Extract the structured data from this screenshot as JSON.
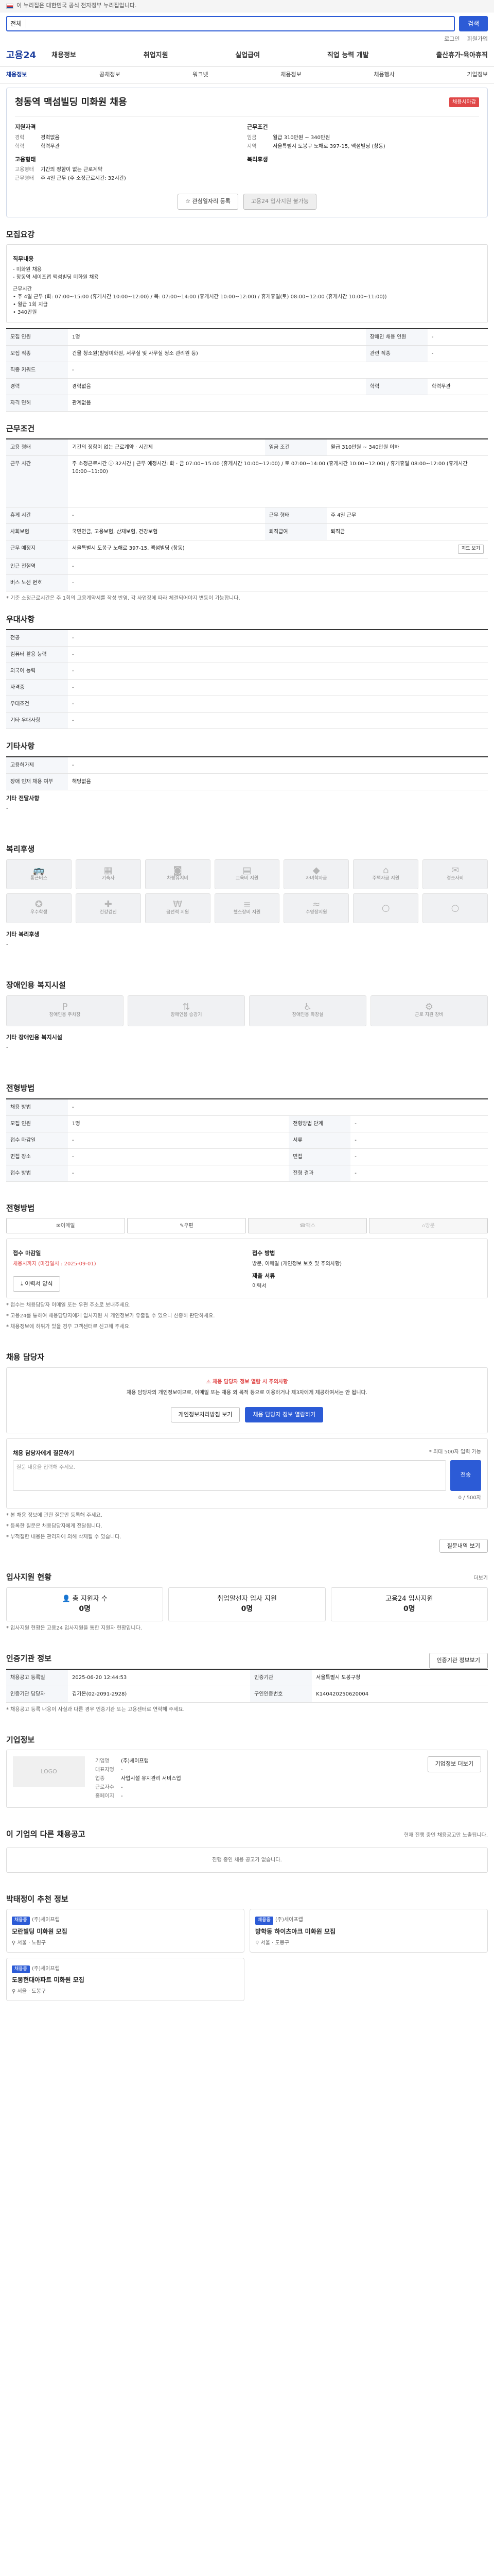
{
  "topbar": {
    "notice": "이 누리집은 대한민국 공식 전자정부 누리집입니다."
  },
  "search": {
    "scope": "전체",
    "placeholder": "",
    "button": "검색"
  },
  "toplinks": [
    "로그인",
    "회원가입"
  ],
  "gnb": {
    "logo": "고용24",
    "menu": [
      "채용정보",
      "취업지원",
      "실업급여",
      "직업 능력 개발",
      "출산휴가·육아휴직"
    ]
  },
  "lnb": {
    "items": [
      "채용정보",
      "공채정보",
      "워크넷",
      "채용정보",
      "채용행사",
      "기업정보"
    ],
    "active_index": 0
  },
  "job": {
    "title": "청동역 맥섬빌딩 미화원 채용",
    "deadline_badge": "채용시마감",
    "qualification": {
      "heading": "지원자격",
      "rows": [
        {
          "k": "경력",
          "v": "경력없음"
        },
        {
          "k": "학력",
          "v": "학력무관"
        }
      ]
    },
    "conditions": {
      "heading": "근무조건",
      "rows": [
        {
          "k": "임금",
          "v": "월급 310만원 ~ 340만원"
        },
        {
          "k": "지역",
          "v": "서울특별시 도봉구 노해로 397-15, 맥섬빌딩 (창동)"
        }
      ]
    },
    "employment": {
      "heading": "고용형태",
      "rows": [
        {
          "k": "고용형태",
          "v": "기간의 정함이 없는 근로계약"
        },
        {
          "k": "근무형태",
          "v": "주 4일 근무 (주 소정근로시간: 32시간)"
        }
      ]
    },
    "company": {
      "heading": "복리후생",
      "rows": []
    },
    "btn_interest": "관심일자리 등록",
    "btn_apply": "고용24 입사지원 불가능"
  },
  "recruit": {
    "heading": "모집요강",
    "duty_heading": "직무내용",
    "duty_lines": [
      "- 미화원 채용",
      "- 창동역 세이프랩 맥섬빌딩 미화원 채용",
      "",
      "근무시간",
      "• 주 4일 근무 (화: 07:00~15:00 (휴게시간 10:00~12:00) / 목: 07:00~14:00 (휴게시간 10:00~12:00) / 휴게휴일(토) 08:00~12:00 (휴게시간 10:00~11:00))",
      "• 월급 1회 지급",
      "• 340만원"
    ],
    "rows": [
      {
        "k": "모집 인원",
        "v": "1명",
        "k2": "장애인 채용 인원",
        "v2": "-"
      },
      {
        "k": "모집 직종",
        "v": "건물 청소원(빌딩미화원, 서무실 및 사무실 청소 관리원 등)",
        "k2": "관련 직종",
        "v2": "-"
      },
      {
        "k": "직종 키워드",
        "v": "-",
        "k2": "",
        "v2": ""
      },
      {
        "k": "경력",
        "v": "경력없음",
        "k2": "학력",
        "v2": "학력무관"
      },
      {
        "k": "자격 면허",
        "v": "관계없음",
        "k2": "",
        "v2": ""
      }
    ]
  },
  "work": {
    "heading": "근무조건",
    "rows": [
      {
        "k": "고용 형태",
        "v": "기간의 정함이 없는 근로계약 · 시간제",
        "k2": "임금 조건",
        "v2": "월급 310만원 ~ 340만원 이하"
      },
      {
        "k": "근무 시간",
        "v": "주 소정근로시간 ⓘ 32시간  |  근무 예정시간: 화 · 금 07:00~15:00 (휴게시간 10:00~12:00) / 토 07:00~14:00 (휴게시간 10:00~12:00) / 휴게휴일 08:00~12:00 (휴게시간 10:00~11:00)",
        "k2": "",
        "v2": ""
      },
      {
        "k": "휴게 시간",
        "v": "-",
        "k2": "근무 형태",
        "v2": "주 4일 근무"
      },
      {
        "k": "사회보험",
        "v": "국민연금, 고용보험, 산재보험, 건강보험",
        "k2": "퇴직급여",
        "v2": "퇴직금"
      },
      {
        "k": "근무 예정지",
        "v": "서울특별시 도봉구 노해로 397-15, 맥섬빌딩 (창동)",
        "k2": "",
        "v2": ""
      },
      {
        "k": "인근 전철역",
        "v": "-",
        "k2": "",
        "v2": ""
      },
      {
        "k": "버스 노선 번호",
        "v": "-",
        "k2": "",
        "v2": ""
      }
    ],
    "map_btn": "지도 보기",
    "note": "* 기준 소정근로시간은 주 1회의 고용계약서를 작성 반영, 각 사업장에 따라 체결되어야지 변동이 가능합니다."
  },
  "prefs": {
    "heading": "우대사항",
    "rows": [
      {
        "k": "전공",
        "v": "-"
      },
      {
        "k": "컴퓨터 활용 능력",
        "v": "-"
      },
      {
        "k": "외국어 능력",
        "v": "-"
      },
      {
        "k": "자격증",
        "v": "-"
      },
      {
        "k": "우대조건",
        "v": "-"
      },
      {
        "k": "기타 우대사항",
        "v": "-"
      }
    ]
  },
  "etc": {
    "heading": "기타사항",
    "rows": [
      {
        "k": "고용허가제",
        "v": "-"
      },
      {
        "k": "장애 인재 채용 여부",
        "v": "해당없음"
      }
    ],
    "extra_title": "기타 전달사항",
    "extra_value": "-"
  },
  "welfare": {
    "heading": "복리후생",
    "items": [
      "통근버스",
      "기숙사",
      "차량유지비",
      "교육비 지원",
      "자녀학자금",
      "주택자금 지원",
      "경조사비",
      "우수학생",
      "건강검진",
      "금전적 지원",
      "헬스장비 지원",
      "수영장지원",
      "",
      ""
    ],
    "extra_title": "기타 복리후생",
    "extra_value": "-"
  },
  "disability": {
    "heading": "장애인용 복지시설",
    "items": [
      "장애인용 주차장",
      "장애인용 승강기",
      "장애인용 화장실",
      "근로 지원 장비"
    ],
    "extra_title": "기타 장애인용 복지시설",
    "extra_value": "-"
  },
  "process": {
    "heading": "전형방법",
    "rows": [
      {
        "k": "채용 방법",
        "v": "-",
        "k2": "",
        "v2": ""
      },
      {
        "k": "모집 인원",
        "v": "1명",
        "k2": "전형방법 단계",
        "v2": "-"
      },
      {
        "k": "접수 마감일",
        "v": "-",
        "k2": "서류",
        "v2": "-"
      },
      {
        "k": "면접 장소",
        "v": "-",
        "k2": "면접",
        "v2": "-"
      },
      {
        "k": "접수 방법",
        "v": "-",
        "k2": "전형 결과",
        "v2": "-"
      }
    ]
  },
  "apply": {
    "heading": "전형방법",
    "tabs": [
      "이메일",
      "우편",
      "팩스",
      "방문"
    ],
    "receive_title": "접수 마감일",
    "receive_value": "채용시까지 (마감일시 : 2025-09-01)",
    "method_title": "접수 방법",
    "method_value": "방문, 이메일 (개인정보 보호 및 주의사항)",
    "docs_title": "제출 서류",
    "docs_value": "이력서",
    "doc_btn": "이력서 양식",
    "notes": [
      "* 접수는 채용담당자 이메일 또는 우편 주소로 보내주세요.",
      "* 고용24를 통하여 채용담당자에게 입사지원 시 개인정보가 유출될 수 있으니 신중히 판단하세요.",
      "* 채용정보에 허위가 있을 경우 고객센터로 신고해 주세요."
    ]
  },
  "contact": {
    "heading": "채용 담당자",
    "warn": "채용 담당자 정보 열람 시 주의사항",
    "msg": "채용 담당자의 개인정보이므로, 이메일 또는 채용 외 목적 등으로 이용하거나 제3자에게 제공하여서는 안 됩니다.",
    "btn_view": "개인정보처리방침 보기",
    "btn_show": "채용 담당자 정보 열람하기",
    "inquiry_title": "채용 담당자에게 질문하기",
    "inquiry_note": "* 최대 500자 입력 가능",
    "inquiry_placeholder": "질문 내용을 입력해 주세요.",
    "inquiry_count": "0 / 500자",
    "inquiry_btn": "전송",
    "inquiry_notes": [
      "* 본 채용 정보에 관한 질문만 등록해 주세요.",
      "* 등록한 질문은 채용담당자에게 전달됩니다.",
      "* 부적절한 내용은 관리자에 의해 삭제될 수 있습니다."
    ],
    "history_btn": "질문내역 보기"
  },
  "stats": {
    "heading": "입사지원 현황",
    "more": "더보기",
    "items": [
      {
        "label": "총 지원자 수",
        "value": "0명"
      },
      {
        "label": "취업알선자 입사 지원",
        "value": "0명"
      },
      {
        "label": "고용24 입사지원",
        "value": "0명"
      }
    ],
    "note": "* 입사지원 현황은 고용24 입사지원을 통한 지원자 현황입니다."
  },
  "manage": {
    "heading": "인증기관 정보",
    "rows": [
      {
        "k": "채용공고 등록일",
        "v": "2025-06-20 12:44:53",
        "k2": "인증기관",
        "v2": "서울특별시 도봉구청"
      },
      {
        "k": "인증기관 담당자",
        "v": "김가온(02-2091-2928)",
        "k2": "구인인증번호",
        "v2": "K140420250620004"
      }
    ],
    "btn": "인증기관 정보보기",
    "note": "* 채용공고 등록 내용이 사실과 다른 경우 인증기관 또는 고용센터로 연락해 주세요."
  },
  "corp": {
    "heading": "기업정보",
    "logo_text": "LOGO",
    "name_label": "기업명",
    "name": "(주)세이프랩",
    "rows": [
      {
        "k": "대표자명",
        "v": "-"
      },
      {
        "k": "업종",
        "v": "사업시설 유지관리 서비스업"
      },
      {
        "k": "근로자수",
        "v": "-"
      },
      {
        "k": "홈페이지",
        "v": "-"
      }
    ],
    "btn": "기업정보 더보기"
  },
  "other": {
    "heading": "이 기업의 다른 채용공고",
    "note": "현재 진행 중인 채용공고만 노출됩니다.",
    "empty": "진행 중인 채용 공고가 없습니다."
  },
  "recommend": {
    "heading": "박태정이 추천 정보",
    "items": [
      {
        "badge": "채용중",
        "company": "(주)세이프랩",
        "title": "모란빌딩 미화원 모집",
        "loc": "서울 · 노원구"
      },
      {
        "badge": "채용중",
        "company": "(주)세이프랩",
        "title": "방학동 하이츠아크 미화원 모집",
        "loc": "서울 · 도봉구"
      },
      {
        "badge": "채용중",
        "company": "(주)세이프랩",
        "title": "도봉현대아파트 미화원 모집",
        "loc": "서울 · 도봉구"
      }
    ]
  }
}
